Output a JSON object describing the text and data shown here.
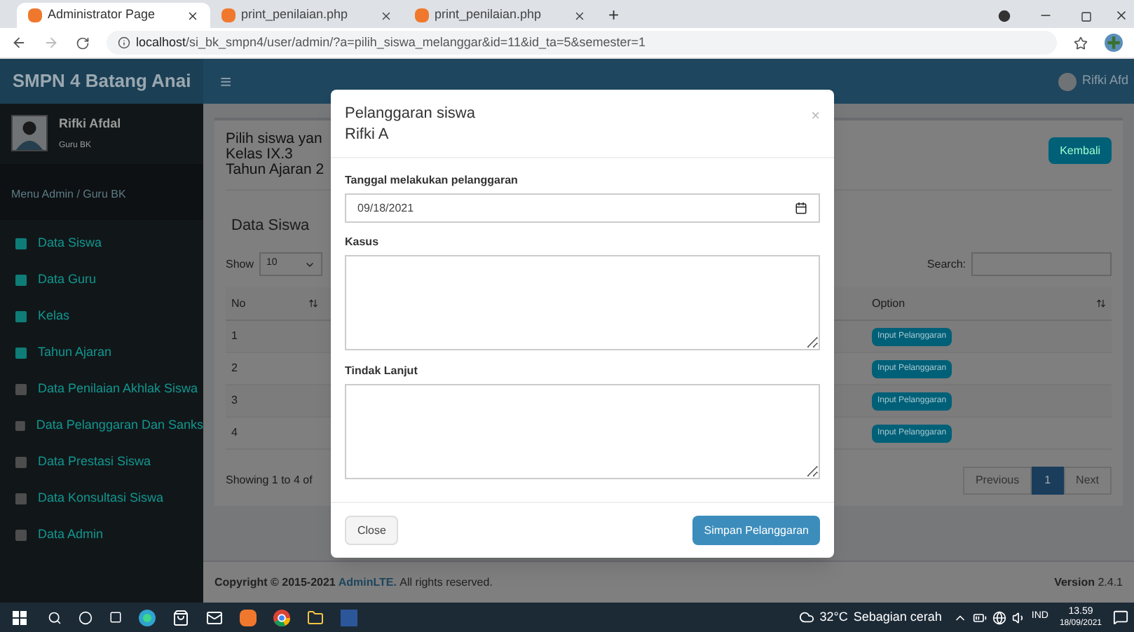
{
  "browser": {
    "tabs": [
      {
        "title": "Administrator Page",
        "selected": true
      },
      {
        "title": "print_penilaian.php",
        "selected": false
      },
      {
        "title": "print_penilaian.php",
        "selected": false
      }
    ],
    "new_tab": "+",
    "url_host": "localhost",
    "url_path": "/si_bk_smpn4/user/admin/?a=pilih_siswa_melanggar&id=11&id_ta=5&semester=1"
  },
  "header": {
    "brand": "SMPN 4 Batang Anai",
    "menu_toggle": "≡",
    "user": "Rifki Afd"
  },
  "sidebar": {
    "user_name": "Rifki Afdal",
    "user_role": "Guru BK",
    "section": "Menu Admin / Guru BK",
    "items": [
      {
        "label": "Data Siswa",
        "color": "#0f7c78"
      },
      {
        "label": "Data Guru",
        "color": "#0f7c78"
      },
      {
        "label": "Kelas",
        "color": "#0f7c78"
      },
      {
        "label": "Tahun Ajaran",
        "color": "#0f7c78"
      },
      {
        "label": "Data Penilaian Akhlak Siswa",
        "color": "#4d4d4d"
      },
      {
        "label": "Data Pelanggaran Dan Sanks",
        "color": "#4d4d4d"
      },
      {
        "label": "Data Prestasi Siswa",
        "color": "#4d4d4d"
      },
      {
        "label": "Data Konsultasi Siswa",
        "color": "#4d4d4d"
      },
      {
        "label": "Data Admin",
        "color": "#4d4d4d"
      }
    ]
  },
  "page": {
    "intro": [
      "Pilih siswa yan",
      "Kelas IX.3",
      "Tahun Ajaran 2"
    ],
    "back_button": "Kembali",
    "box_title": "Data Siswa",
    "show_label": "Show",
    "page_size": "10",
    "search_label": "Search:",
    "columns": [
      "No",
      "Option"
    ],
    "rows": [
      {
        "no": "1",
        "action": "Input Pelanggaran"
      },
      {
        "no": "2",
        "action": "Input Pelanggaran"
      },
      {
        "no": "3",
        "action": "Input Pelanggaran"
      },
      {
        "no": "4",
        "action": "Input Pelanggaran"
      }
    ],
    "info": "Showing 1 to 4 of",
    "pagination": [
      {
        "label": "Previous",
        "selected": false
      },
      {
        "label": "1",
        "selected": true
      },
      {
        "label": "Next",
        "selected": false
      }
    ]
  },
  "footer": {
    "prefix": "Copyright © 2015-2021",
    "link": "AdminLTE.",
    "suffix": "All rights reserved.",
    "version_label": "Version",
    "version": "2.4.1"
  },
  "modal": {
    "title": "Pelanggaran siswa",
    "subtitle": "Rifki A",
    "close": "×",
    "date_label": "Tanggal melakukan pelanggaran",
    "date_value": "09/18/2021",
    "case_label": "Kasus",
    "followup_label": "Tindak Lanjut",
    "close_button": "Close",
    "save_button": "Simpan Pelanggaran"
  },
  "taskbar": {
    "temperature": "32°C",
    "weather": "Sebagian cerah",
    "language": "IND",
    "time": "13.59",
    "date": "18/09/2021"
  }
}
